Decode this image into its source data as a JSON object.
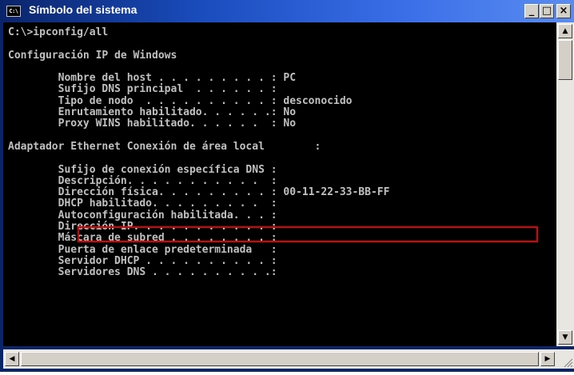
{
  "window": {
    "title": "Símbolo del sistema",
    "icon_label": "C:\\",
    "controls": {
      "minimize": "_",
      "maximize": "□",
      "close": "×"
    }
  },
  "console": {
    "lines": [
      "C:\\>ipconfig/all",
      "",
      "Configuración IP de Windows",
      "",
      "        Nombre del host . . . . . . . . . : PC",
      "        Sufijo DNS principal  . . . . . . :",
      "        Tipo de nodo  . . . . . . . . . . : desconocido",
      "        Enrutamiento habilitado. . . . . .: No",
      "        Proxy WINS habilitado. . . . . .  : No",
      "",
      "Adaptador Ethernet Conexión de área local        :",
      "",
      "        Sufijo de conexión específica DNS :",
      "        Descripción. . . . . . . . . . .  :",
      "        Dirección física. . . . . . . . . : 00-11-22-33-BB-FF",
      "        DHCP habilitado. . . . . . . . .  :",
      "        Autoconfiguración habilitada. . . :",
      "        Dirección IP. . . . . . . . . . . :",
      "        Máscara de subred . . . . . . . . :",
      "        Puerta de enlace predeterminada   :",
      "        Servidor DHCP . . . . . . . . . . :",
      "        Servidores DNS . . . . . . . . . .:"
    ],
    "text_color": "#c0c0c0",
    "background": "#000000",
    "highlight_color": "#e00000"
  },
  "scrollbars": {
    "up_arrow": "▲",
    "down_arrow": "▼",
    "left_arrow": "◀",
    "right_arrow": "▶"
  }
}
